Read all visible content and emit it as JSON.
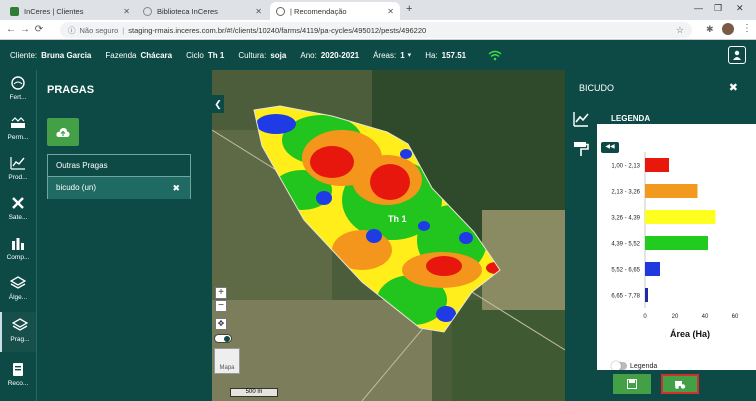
{
  "browser": {
    "tabs": [
      {
        "title": "InCeres | Clientes",
        "active": false
      },
      {
        "title": "Biblioteca InCeres",
        "active": false
      },
      {
        "title": "| Recomendação",
        "active": true
      }
    ],
    "security_label": "Não seguro",
    "url": "staging-rmais.inceres.com.br/#!/clients/10240/farms/4119/pa-cycles/495012/pests/496220"
  },
  "appbar": {
    "client_label": "Cliente:",
    "client_value": "Bruna Garcia",
    "farm_label": "Fazenda",
    "farm_value": "Chácara",
    "cycle_label": "Ciclo",
    "cycle_value": "Th 1",
    "crop_label": "Cultura:",
    "crop_value": "soja",
    "year_label": "Ano:",
    "year_value": "2020-2021",
    "areas_label": "Áreas:",
    "areas_value": "1",
    "ha_label": "Ha:",
    "ha_value": "157.51"
  },
  "sidebar": {
    "items": [
      {
        "label": "Fert..."
      },
      {
        "label": "Perm..."
      },
      {
        "label": "Prod..."
      },
      {
        "label": "Sate..."
      },
      {
        "label": "Comp..."
      },
      {
        "label": "Álge..."
      },
      {
        "label": "Prag...",
        "active": true
      },
      {
        "label": "Reco..."
      }
    ]
  },
  "pests_panel": {
    "title": "PRAGAS",
    "items": [
      {
        "label": "Outras Pragas"
      },
      {
        "label": "bicudo (un)",
        "selected": true
      }
    ]
  },
  "map": {
    "field_label": "Th 1",
    "scale_label": "500 m",
    "zoom_in": "+",
    "zoom_out": "−",
    "thumb_label": "Mapa"
  },
  "right_panel": {
    "title": "BICUDO",
    "legend_title": "LEGENDA",
    "legend_checkbox_label": "Legenda"
  },
  "chart_data": {
    "type": "bar",
    "orientation": "horizontal",
    "categories": [
      "1,00 - 2,13",
      "2,13 - 3,26",
      "3,26 - 4,39",
      "4,39 - 5,52",
      "5,52 - 6,65",
      "6,65 - 7,78"
    ],
    "values": [
      16,
      35,
      47,
      42,
      10,
      2
    ],
    "colors": [
      "#e8190c",
      "#f29a1e",
      "#ffff1f",
      "#22cc1e",
      "#1f38e0",
      "#1f2aa8"
    ],
    "xlabel": "Área (Ha)",
    "xlim": [
      0,
      60
    ],
    "xticks": [
      "0",
      "20",
      "40",
      "60"
    ]
  }
}
